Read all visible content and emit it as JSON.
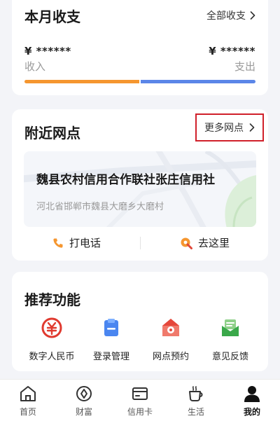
{
  "income_card": {
    "title": "本月收支",
    "all_link": "全部收支",
    "income_amount": "¥ ******",
    "expense_amount": "¥ ******",
    "income_label": "收入",
    "expense_label": "支出",
    "colors": {
      "income": "#f5962f",
      "expense": "#5b86e8"
    }
  },
  "branch_card": {
    "title": "附近网点",
    "more_link": "更多网点",
    "branch_name": "魏县农村信用合作联社张庄信用社",
    "branch_address": "河北省邯郸市魏县大磨乡大磨村",
    "call_label": "打电话",
    "navigate_label": "去这里",
    "highlight_color": "#d0202a"
  },
  "features_card": {
    "title": "推荐功能",
    "items": [
      {
        "label": "数字人民币",
        "icon": "digital-rmb-icon"
      },
      {
        "label": "登录管理",
        "icon": "login-management-icon"
      },
      {
        "label": "网点预约",
        "icon": "branch-appointment-icon"
      },
      {
        "label": "意见反馈",
        "icon": "feedback-icon"
      }
    ]
  },
  "tabbar": {
    "items": [
      {
        "label": "首页",
        "icon": "home-icon"
      },
      {
        "label": "财富",
        "icon": "wealth-icon"
      },
      {
        "label": "信用卡",
        "icon": "credit-card-icon"
      },
      {
        "label": "生活",
        "icon": "life-coffee-icon"
      },
      {
        "label": "我的",
        "icon": "profile-icon"
      }
    ],
    "active": "我的"
  }
}
